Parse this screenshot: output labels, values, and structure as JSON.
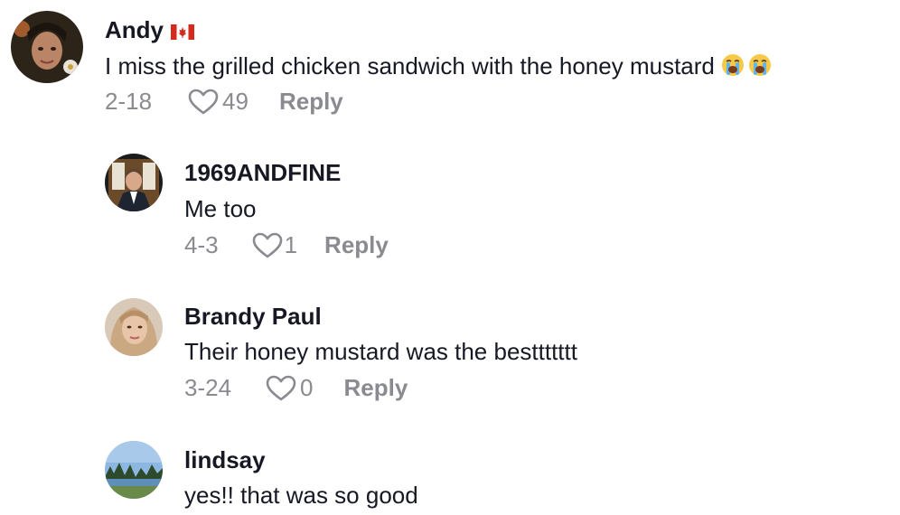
{
  "comments": [
    {
      "username": "Andy",
      "flag_icon": "canada-flag-icon",
      "text": "I miss the grilled chicken sandwich with the honey mustard",
      "emoji_icon": "loudly-crying-face-icon",
      "date": "2-18",
      "likes": "49",
      "reply_label": "Reply"
    },
    {
      "username": "1969ANDFINE",
      "text": "Me too",
      "date": "4-3",
      "likes": "1",
      "reply_label": "Reply"
    },
    {
      "username": "Brandy Paul",
      "text": "Their honey mustard was the besttttttt",
      "date": "3-24",
      "likes": "0",
      "reply_label": "Reply"
    },
    {
      "username": "lindsay",
      "text": "yes!! that was so good"
    }
  ],
  "colors": {
    "text": "#161823",
    "meta": "#8a8b91",
    "flag_red": "#d52b1e"
  }
}
